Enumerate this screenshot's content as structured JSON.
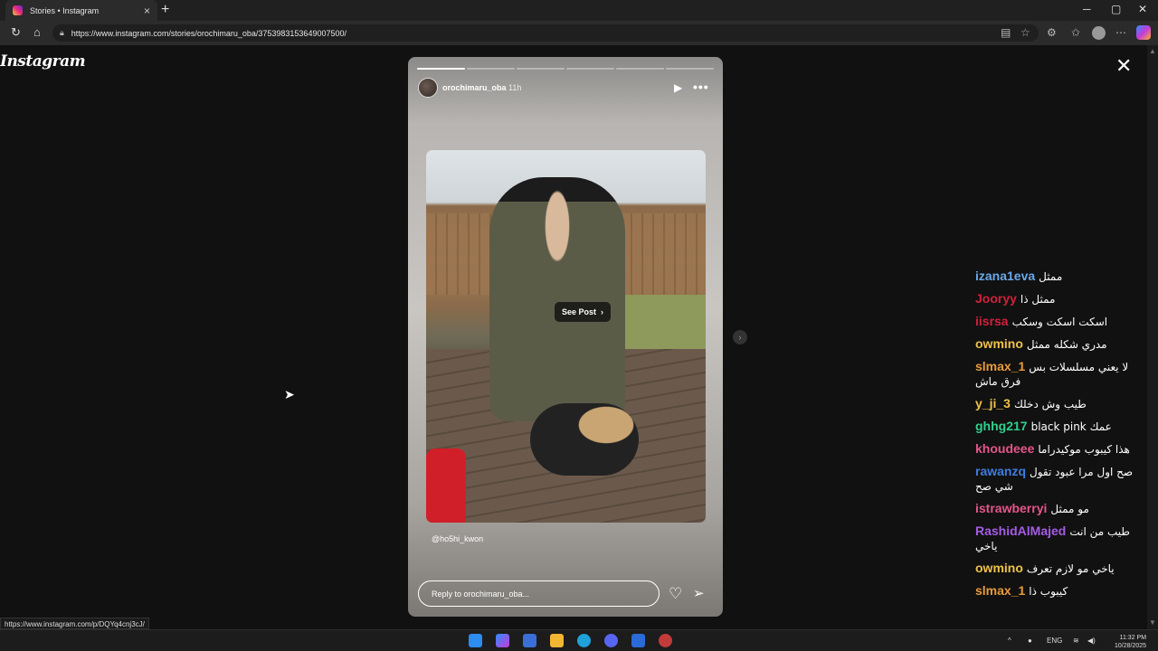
{
  "browser": {
    "tab_title": "Stories • Instagram",
    "tab_close": "×",
    "new_tab": "+",
    "url": "https://www.instagram.com/stories/orochimaru_oba/3753983153649007500/",
    "minimize": "─",
    "maximize": "▢",
    "close": "✕"
  },
  "page": {
    "logo": "Instagram",
    "close_story": "✕"
  },
  "story": {
    "username": "orochimaru_oba",
    "time": "11h",
    "progress_done": 1,
    "progress_total": 6,
    "see_post": "See Post",
    "mention": "@ho5hi_kwon",
    "reply_placeholder": "Reply to orochimaru_oba..."
  },
  "status_url": "https://www.instagram.com/p/DQYq4cnj3cJ/",
  "chat": [
    {
      "user": "izana1eva",
      "text": "ممثل",
      "color": "#6aa9e8"
    },
    {
      "user": "Jooryy",
      "text": "ممثل ذا",
      "color": "#d0213b"
    },
    {
      "user": "iisrsa",
      "text": "اسكت اسكت وسكب",
      "color": "#d0213b"
    },
    {
      "user": "owmino",
      "text": "مدري شكله ممثل",
      "color": "#f0c24a"
    },
    {
      "user": "slmax_1",
      "text": "لا يعني مسلسلات بس فرق ماش",
      "color": "#e89b3a"
    },
    {
      "user": "y_ji_3",
      "text": "طيب وش دخلك",
      "color": "#f0c24a"
    },
    {
      "user": "ghhg217",
      "text": "black pink عمك",
      "color": "#2fcf8c"
    },
    {
      "user": "khoudeee",
      "text": "هذا كيبوب موكيدراما",
      "color": "#e5558a"
    },
    {
      "user": "rawanzq",
      "text": "صح اول مرا عبود تقول شي صح",
      "color": "#3d7de0"
    },
    {
      "user": "istrawberryi",
      "text": "مو ممثل",
      "color": "#e5558a"
    },
    {
      "user": "RashidAlMajed",
      "text": "طيب من انت ياخي",
      "color": "#a55ce6"
    },
    {
      "user": "owmino",
      "text": "ياخي مو لازم تعرف",
      "color": "#f0c24a"
    },
    {
      "user": "slmax_1",
      "text": "كيبوب ذا",
      "color": "#e89b3a"
    }
  ],
  "taskbar": {
    "lang": "ENG",
    "time": "11:32 PM",
    "date": "10/28/2025"
  }
}
